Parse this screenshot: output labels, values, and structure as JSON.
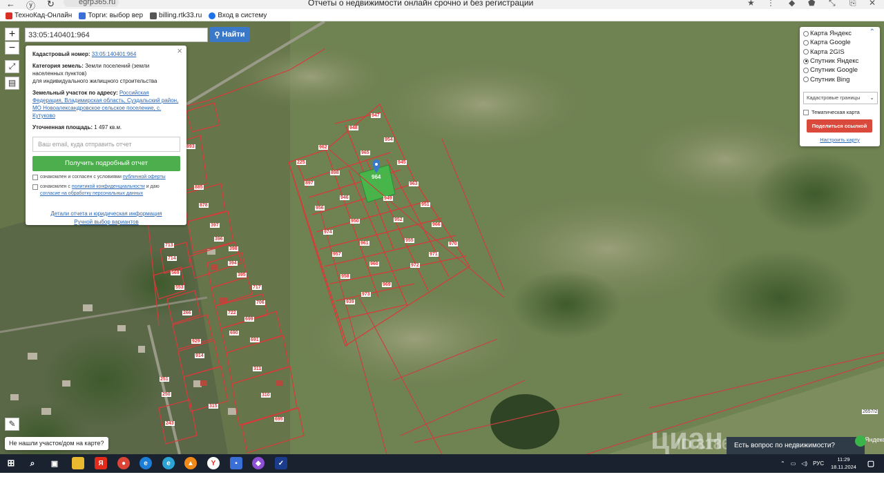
{
  "browser": {
    "url": "egrp365.ru",
    "page_title": "Отчеты о недвижимости онлайн срочно и без регистрации",
    "bookmarks": [
      {
        "label": "ТехноКад-Онлайн",
        "color": "#d93025"
      },
      {
        "label": "Торги: выбор вер",
        "color": "#3b6fd8"
      },
      {
        "label": "billing.rtk33.ru",
        "color": "#555555"
      },
      {
        "label": "Вход в систему",
        "color": "#1a73e8"
      }
    ]
  },
  "search": {
    "value": "33:05:140401:964",
    "button_label": "Найти"
  },
  "map_controls": {
    "zoom_in": "+",
    "zoom_out": "−"
  },
  "popup": {
    "cad_label": "Кадастровый номер:",
    "cad_value": "33:05:140401:964",
    "category_label": "Категория земель:",
    "category_value": "Земли поселений (земли населенных пунктов)",
    "category_use": "для индивидуального жилищного строительства",
    "address_label": "Земельный участок по адресу:",
    "address_value": "Российская Федерация, Владимирская область, Суздальский район, МО Новоалександровское сельское поселение, с. Кутуково",
    "area_label": "Уточненная площадь:",
    "area_value": "1 497 кв.м.",
    "email_placeholder": "Ваш email, куда отправить отчет",
    "report_button": "Получить подробный отчет",
    "agree1_text": "ознакомлен и согласен с условиями",
    "agree1_link": "публичной оферты",
    "agree2_text": "ознакомлен с",
    "agree2_link": "политикой конфиденциальности",
    "agree2_and": "и даю",
    "agree2_link2": "согласие на обработку персональных данных",
    "details_link": "Детали отчета и юридическая информация",
    "manual_link": "Ручной выбор вариантов"
  },
  "layers": {
    "options": [
      {
        "label": "Карта Яндекс",
        "selected": false
      },
      {
        "label": "Карта Google",
        "selected": false
      },
      {
        "label": "Карта 2GIS",
        "selected": false
      },
      {
        "label": "Спутник Яндекс",
        "selected": true
      },
      {
        "label": "Спутник Google",
        "selected": false
      },
      {
        "label": "Спутник Bing",
        "selected": false
      }
    ],
    "select_value": "Кадастровые границы",
    "thematic_label": "Тематическая карта",
    "share_button": "Поделиться ссылкой",
    "config_link": "Настроить карту"
  },
  "map": {
    "not_found": "Не нашли участок/дом на карте?",
    "question": "Есть вопрос по недвижимости?",
    "watermark": "циан",
    "watermark_id": "ID 31867023",
    "parcel_label": "2657/2",
    "yandex_label": "Яндекс",
    "highlighted_parcel": "964",
    "parcel_numbers": [
      "947",
      "948",
      "954",
      "962",
      "965",
      "945",
      "225",
      "898",
      "963",
      "897",
      "946",
      "949",
      "951",
      "956",
      "950",
      "952",
      "966",
      "974",
      "961",
      "955",
      "970",
      "957",
      "960",
      "971",
      "972",
      "958",
      "969",
      "973",
      "939"
    ],
    "left_parcel_numbers": [
      "893",
      "885",
      "878",
      "397",
      "396",
      "713",
      "398",
      "714",
      "394",
      "569",
      "395",
      "553",
      "717",
      "706",
      "266",
      "722",
      "699",
      "690",
      "691",
      "929",
      "914",
      "311",
      "310",
      "315",
      "695",
      "243",
      "250",
      "251"
    ]
  },
  "taskbar": {
    "lang": "РУС",
    "time": "11:29",
    "date": "18.11.2024"
  }
}
